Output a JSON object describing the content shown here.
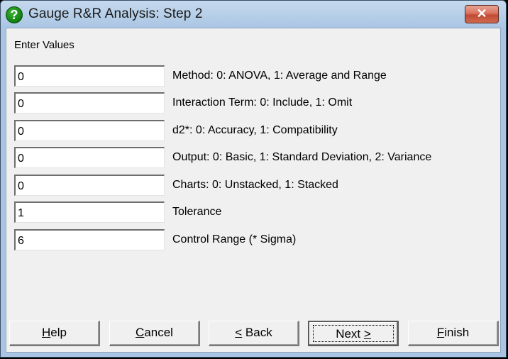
{
  "window": {
    "title": "Gauge R&R Analysis: Step 2",
    "icon": "help-question-icon",
    "close_glyph": "✕"
  },
  "section_label": "Enter Values",
  "fields": [
    {
      "value": "0",
      "label": "Method: 0: ANOVA, 1: Average and Range"
    },
    {
      "value": "0",
      "label": "Interaction Term: 0: Include, 1: Omit"
    },
    {
      "value": "0",
      "label": "d2*: 0: Accuracy, 1: Compatibility"
    },
    {
      "value": "0",
      "label": "Output: 0: Basic, 1: Standard Deviation, 2: Variance"
    },
    {
      "value": "0",
      "label": "Charts: 0: Unstacked, 1: Stacked"
    },
    {
      "value": "1",
      "label": "Tolerance"
    },
    {
      "value": "6",
      "label": "Control Range (* Sigma)"
    }
  ],
  "buttons": {
    "help": {
      "mnemonic": "H",
      "rest": "elp"
    },
    "cancel": {
      "mnemonic": "C",
      "rest": "ancel"
    },
    "back": {
      "mnemonic": "<",
      "rest": " Back"
    },
    "next": {
      "prefix": "Next ",
      "mnemonic": ">"
    },
    "finish": {
      "mnemonic": "F",
      "rest": "inish"
    }
  }
}
